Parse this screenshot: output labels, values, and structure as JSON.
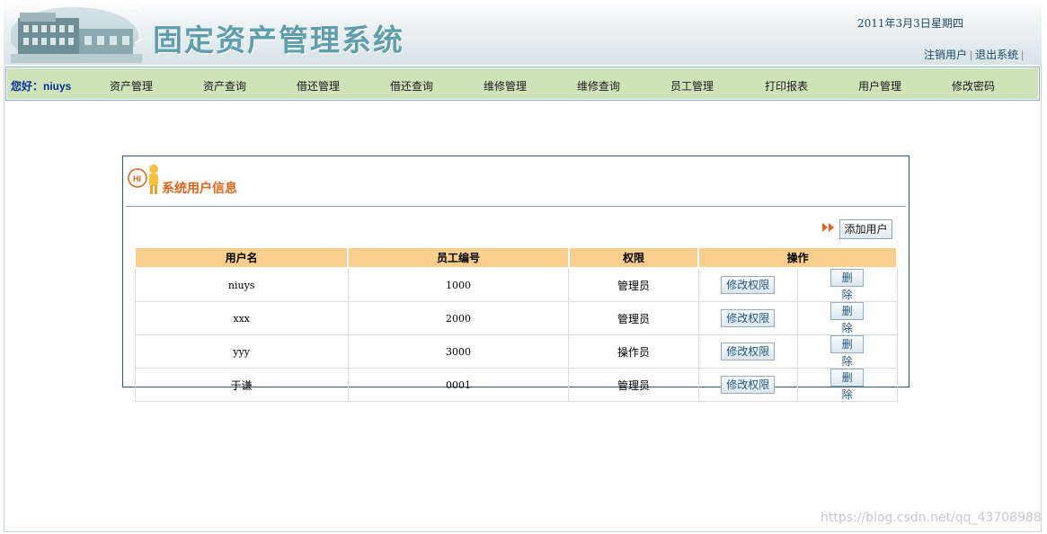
{
  "header": {
    "title": "固定资产管理系统",
    "date": "2011年3月3日",
    "weekday": "星期四",
    "links": [
      "注销用户",
      "退出系统"
    ]
  },
  "nav": {
    "greeting": "您好：niuys",
    "items": [
      "资产管理",
      "资产查询",
      "借还管理",
      "借还查询",
      "维修管理",
      "维修查询",
      "员工管理",
      "打印报表",
      "用户管理",
      "修改密码"
    ]
  },
  "panel": {
    "title": "系统用户信息",
    "hi_badge": "HI",
    "add_button": "添加用户",
    "columns": [
      "用户名",
      "员工编号",
      "权限",
      "操作"
    ],
    "rows": [
      {
        "username": "niuys",
        "employee_no": "1000",
        "role": "管理员"
      },
      {
        "username": "xxx",
        "employee_no": "2000",
        "role": "管理员"
      },
      {
        "username": "yyy",
        "employee_no": "3000",
        "role": "操作员"
      },
      {
        "username": "于谦",
        "employee_no": "0001",
        "role": "管理员"
      }
    ],
    "edit_label": "修改权限",
    "delete_label": "删除"
  },
  "watermark": "https://blog.csdn.net/qq_43708988",
  "colors": {
    "title": "#5f9eaa",
    "nav_bg": "#cfe3b9",
    "greeting": "#0a2e9c",
    "panel_title": "#e0641a",
    "table_header": "#f8cf8d"
  }
}
